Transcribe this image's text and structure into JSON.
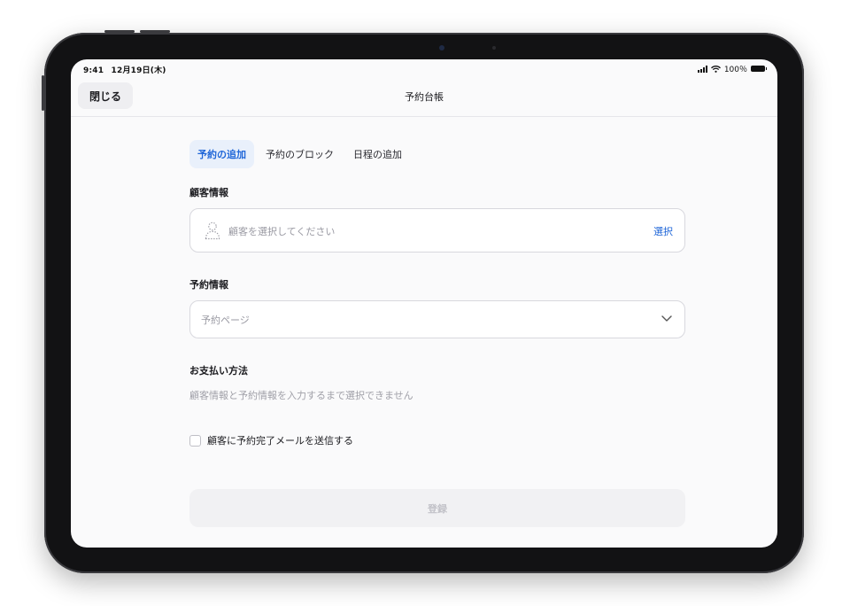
{
  "status_bar": {
    "time": "9:41",
    "date": "12月19日(木)",
    "battery": "100％"
  },
  "nav": {
    "close_label": "閉じる",
    "title": "予約台帳"
  },
  "tabs": [
    {
      "label": "予約の追加",
      "active": true
    },
    {
      "label": "予約のブロック",
      "active": false
    },
    {
      "label": "日程の追加",
      "active": false
    }
  ],
  "customer_section": {
    "heading": "顧客情報",
    "placeholder": "顧客を選択してください",
    "select_label": "選択"
  },
  "reservation_section": {
    "heading": "予約情報",
    "page_placeholder": "予約ページ"
  },
  "payment_section": {
    "heading": "お支払い方法",
    "note": "顧客情報と予約情報を入力するまで選択できません"
  },
  "notify_checkbox": {
    "label": "顧客に予約完了メールを送信する",
    "checked": false
  },
  "register_button": {
    "label": "登録",
    "enabled": false
  },
  "colors": {
    "accent": "#1f66d8",
    "tab_active_bg": "#e9f0fb",
    "placeholder": "#9a9aa3",
    "disabled_button_bg": "#f1f1f3"
  },
  "icons": {
    "customer": "person-dotted-icon",
    "dropdown": "chevron-down-icon",
    "wifi": "wifi-icon",
    "signal": "signal-icon",
    "battery": "battery-icon"
  }
}
